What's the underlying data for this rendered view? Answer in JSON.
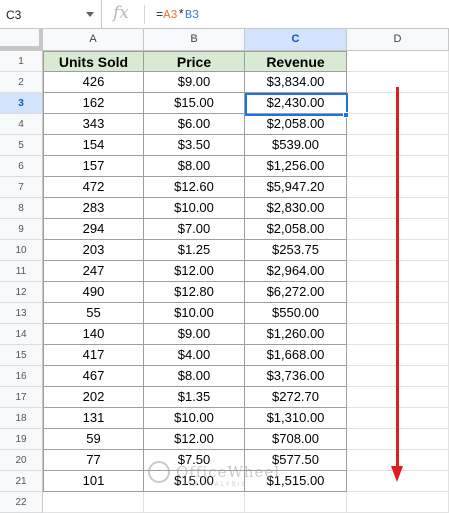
{
  "formula_bar": {
    "name_box": "C3",
    "fx_label": "fx",
    "formula_prefix": "=",
    "formula_ref1": "A3",
    "formula_op": "*",
    "formula_ref2": "B3"
  },
  "columns": [
    "A",
    "B",
    "C",
    "D"
  ],
  "rows": [
    "1",
    "2",
    "3",
    "4",
    "5",
    "6",
    "7",
    "8",
    "9",
    "10",
    "11",
    "12",
    "13",
    "14",
    "15",
    "16",
    "17",
    "18",
    "19",
    "20",
    "21",
    "22"
  ],
  "headers": {
    "a": "Units Sold",
    "b": "Price",
    "c": "Revenue"
  },
  "data": [
    [
      "426",
      "$9.00",
      "$3,834.00"
    ],
    [
      "162",
      "$15.00",
      "$2,430.00"
    ],
    [
      "343",
      "$6.00",
      "$2,058.00"
    ],
    [
      "154",
      "$3.50",
      "$539.00"
    ],
    [
      "157",
      "$8.00",
      "$1,256.00"
    ],
    [
      "472",
      "$12.60",
      "$5,947.20"
    ],
    [
      "283",
      "$10.00",
      "$2,830.00"
    ],
    [
      "294",
      "$7.00",
      "$2,058.00"
    ],
    [
      "203",
      "$1.25",
      "$253.75"
    ],
    [
      "247",
      "$12.00",
      "$2,964.00"
    ],
    [
      "490",
      "$12.80",
      "$6,272.00"
    ],
    [
      "55",
      "$10.00",
      "$550.00"
    ],
    [
      "140",
      "$9.00",
      "$1,260.00"
    ],
    [
      "417",
      "$4.00",
      "$1,668.00"
    ],
    [
      "467",
      "$8.00",
      "$3,736.00"
    ],
    [
      "202",
      "$1.35",
      "$272.70"
    ],
    [
      "131",
      "$10.00",
      "$1,310.00"
    ],
    [
      "59",
      "$12.00",
      "$708.00"
    ],
    [
      "77",
      "$7.50",
      "$577.50"
    ],
    [
      "101",
      "$15.00",
      "$1,515.00"
    ]
  ],
  "selected_cell": "C3",
  "watermark": {
    "text": "OfficeWheel",
    "sub": "DATA  ANALYSIS"
  },
  "colors": {
    "header_fill": "#d9ead3",
    "selection": "#1a73e8",
    "arrow": "#e21b1b"
  }
}
